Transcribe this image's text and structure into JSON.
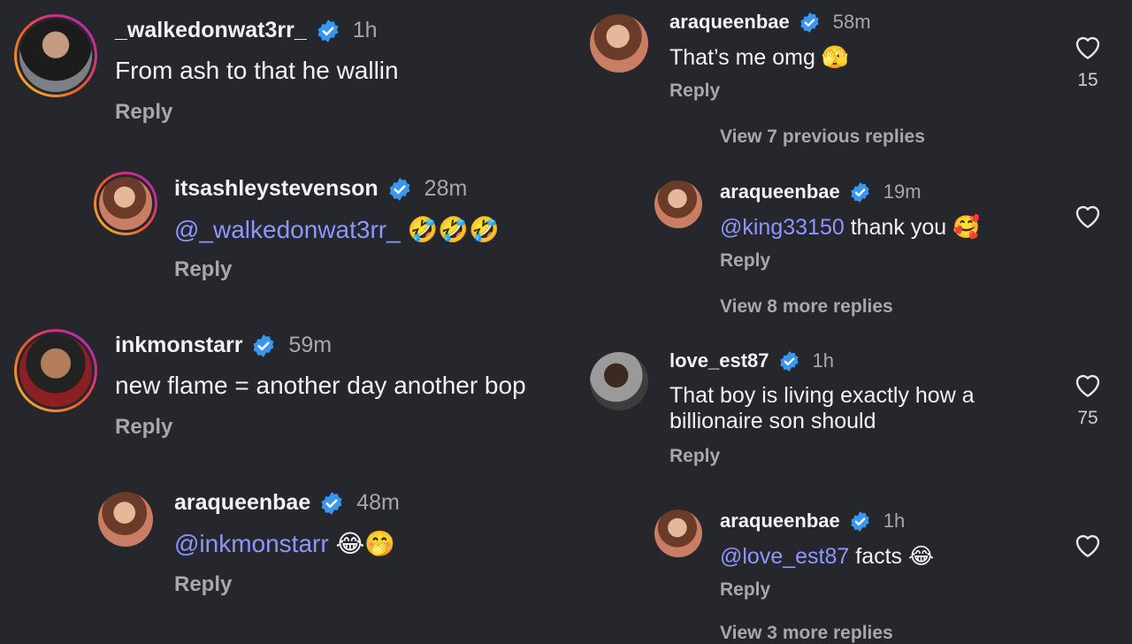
{
  "left": {
    "c1": {
      "username": "_walkedonwat3rr_",
      "time": "1h",
      "text": "From ash to that he wallin",
      "reply": "Reply"
    },
    "c2": {
      "username": "itsashleystevenson",
      "time": "28m",
      "mention": "@_walkedonwat3rr_",
      "emoji": "🤣🤣🤣",
      "reply": "Reply"
    },
    "c3": {
      "username": "inkmonstarr",
      "time": "59m",
      "text": "new flame = another day another bop",
      "reply": "Reply"
    },
    "c4": {
      "username": "araqueenbae",
      "time": "48m",
      "mention": "@inkmonstarr",
      "emoji": "😂🤭",
      "reply": "Reply"
    }
  },
  "right": {
    "c1": {
      "username": "araqueenbae",
      "time": "58m",
      "text": "That’s me omg",
      "emoji": "🫣",
      "reply": "Reply",
      "likes": "15"
    },
    "view_previous": "View 7 previous replies",
    "c2": {
      "username": "araqueenbae",
      "time": "19m",
      "mention": "@king33150",
      "text": "thank you",
      "emoji": "🥰",
      "reply": "Reply"
    },
    "view_more_1": "View 8 more replies",
    "c3": {
      "username": "love_est87",
      "time": "1h",
      "text_line1": "That boy is living exactly how a",
      "text_line2": "billionaire son should",
      "reply": "Reply",
      "likes": "75"
    },
    "c4": {
      "username": "araqueenbae",
      "time": "1h",
      "mention": "@love_est87",
      "text": "facts",
      "emoji": "😂",
      "reply": "Reply"
    },
    "view_more_2": "View 3 more replies"
  },
  "colors": {
    "background": "#25272c",
    "mention": "#8f95ff",
    "verified": "#3897f0",
    "muted": "#a8a8a8"
  }
}
